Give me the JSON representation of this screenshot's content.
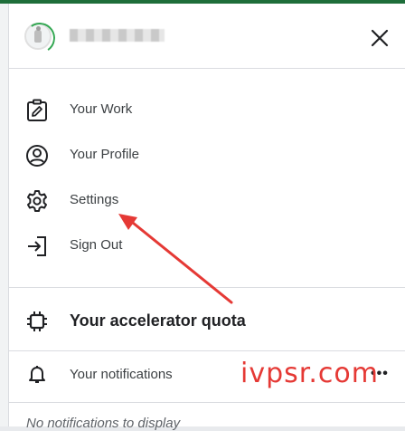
{
  "header": {
    "close_icon": "close-icon"
  },
  "menu": {
    "items": [
      {
        "label": "Your Work",
        "icon": "edit-document-icon"
      },
      {
        "label": "Your Profile",
        "icon": "account-circle-icon"
      },
      {
        "label": "Settings",
        "icon": "gear-icon"
      },
      {
        "label": "Sign Out",
        "icon": "sign-out-icon"
      }
    ]
  },
  "quota": {
    "label": "Your accelerator quota",
    "icon": "chip-icon"
  },
  "notifications": {
    "label": "Your notifications",
    "more": "•••",
    "empty_text": "No notifications to display"
  },
  "watermark": {
    "text": "ivpsr.com"
  },
  "colors": {
    "accent_green": "#34a853",
    "arrow_red": "#e53935",
    "divider": "#dadce0"
  }
}
